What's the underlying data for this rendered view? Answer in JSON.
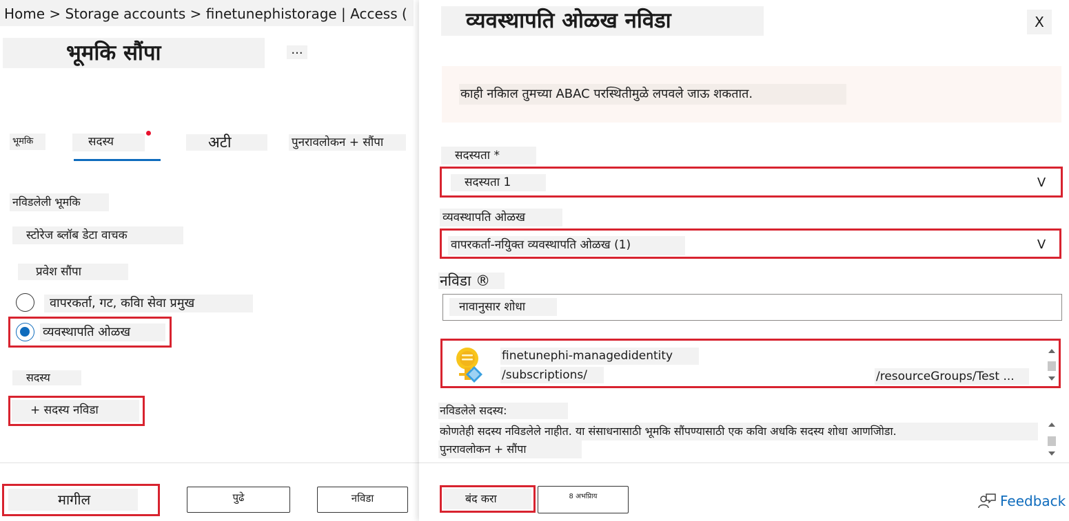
{
  "breadcrumb": "Home > Storage accounts > finetunephistorage | Access (",
  "page": {
    "title": "भूमकि सौंपा",
    "more": "..."
  },
  "tabs": [
    {
      "label": "भूमकि"
    },
    {
      "label": "सदस्य",
      "active": true
    },
    {
      "label": "अटी"
    },
    {
      "label": "पुनरावलोकन + सौंपा"
    }
  ],
  "form": {
    "selected_role_label": "नविडलेली भूमकि",
    "selected_role_value": "स्टोरेज ब्लॉब डेटा वाचक",
    "assign_access_label": "प्रवेश सौंपा",
    "options": [
      {
        "label": "वापरकर्ता, गट, कवि‍ा सेवा प्रमुख",
        "selected": false
      },
      {
        "label": "व्यवस्थापति ओळख",
        "selected": true
      }
    ],
    "members_label": "सदस्य",
    "select_members": "+ सदस्य नविडा"
  },
  "footer_left": {
    "back": "मागील",
    "next": "पुढे",
    "select": "नविडा"
  },
  "pane": {
    "title": "व्यवस्थापति ओळख नविडा",
    "close": "X",
    "warning": "काही नकािल तुमच्या ABAC परस्थितीमुळे लपवले जाऊ शकतात.",
    "subscription_label": "सदस्यता *",
    "subscription_value": "सदस्यता 1",
    "managed_identity_label": "व्यवस्थापति ओळख",
    "managed_identity_value": "वापरकर्ता-नयिुक्त व्यवस्थापति ओळख (1)",
    "chevron": "V",
    "select_label": "नविडा ®",
    "search_placeholder": "नावानुसार शोधा",
    "result": {
      "name": "finetunephi-managedidentity",
      "path_a": "/subscriptions/",
      "path_b": "/resourceGroups/Test ..."
    },
    "selected_members_label": "नविडलेले सदस्य:",
    "no_members_text": "कोणतेही सदस्य नविडलेले नाहीत. या संसाधनासाठी भूमकि सौंपण्यासाठी एक कवि‍ा अधकि सदस्य शोधा आणजिोडा.",
    "review_assign": "पुनरावलोकन + सौंपा"
  },
  "footer_right": {
    "close": "बंद करा",
    "feedback_small": "8 अभप्रािय",
    "feedback": "Feedback"
  },
  "colors": {
    "highlight_box": "#d8232f",
    "accent": "#0f6cbd",
    "warning_bg": "#fdf6f3"
  },
  "icons": [
    "key-identity-icon",
    "feedback-person-icon",
    "close-icon",
    "chevron-down-icon"
  ]
}
